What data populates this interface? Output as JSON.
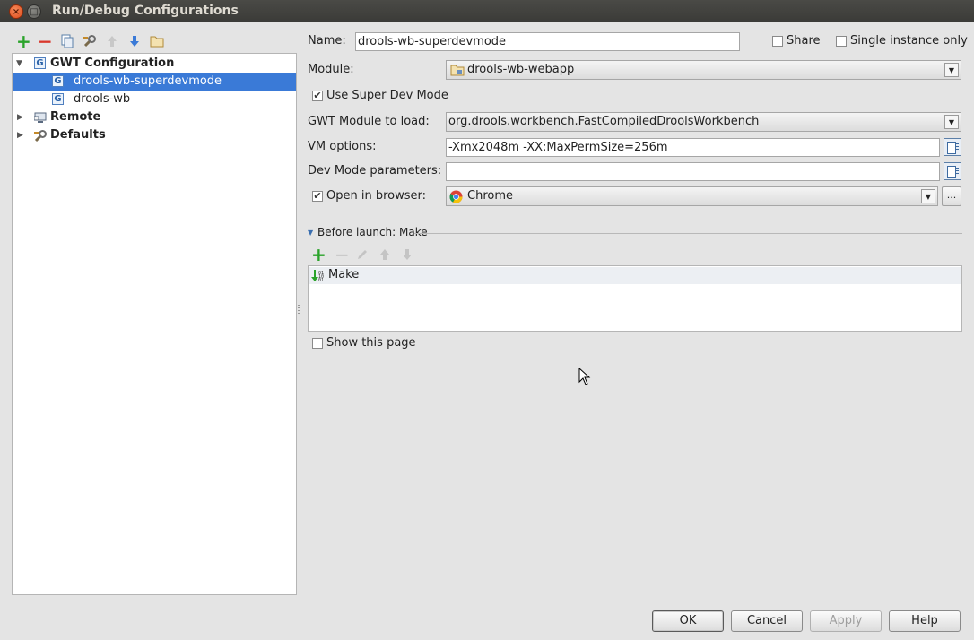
{
  "window": {
    "title": "Run/Debug Configurations",
    "close_glyph": "×",
    "maximize_glyph": "□"
  },
  "toolbar": {
    "icons": [
      "add-icon",
      "remove-icon",
      "copy-icon",
      "wrench-icon",
      "move-up-icon",
      "move-down-icon",
      "folder-icon"
    ],
    "add_glyph": "+",
    "remove_glyph": "−"
  },
  "tree": {
    "gwt": {
      "label": "GWT Configuration",
      "expanded": true
    },
    "items": [
      {
        "label": "drools-wb-superdevmode",
        "selected": true
      },
      {
        "label": "drools-wb",
        "selected": false
      }
    ],
    "remote": {
      "label": "Remote"
    },
    "defaults": {
      "label": "Defaults"
    },
    "g_glyph": "G"
  },
  "form": {
    "name_label": "Name:",
    "name_value": "drools-wb-superdevmode",
    "share_label": "Share",
    "share_checked": false,
    "single_instance_label": "Single instance only",
    "single_instance_checked": false,
    "module_label": "Module:",
    "module_value": "drools-wb-webapp",
    "use_super_dev_label": "Use Super Dev Mode",
    "use_super_dev_checked": true,
    "gwt_module_label": "GWT Module to load:",
    "gwt_module_value": "org.drools.workbench.FastCompiledDroolsWorkbench",
    "vm_options_label": "VM options:",
    "vm_options_value": "-Xmx2048m -XX:MaxPermSize=256m",
    "dev_mode_label": "Dev Mode parameters:",
    "dev_mode_value": "",
    "open_browser_label": "Open in browser:",
    "open_browser_checked": true,
    "browser_value": "Chrome",
    "browse_glyph": "...",
    "check_glyph": "✔",
    "dropdown_glyph": "▼"
  },
  "before_launch": {
    "header": "Before launch: Make",
    "tasks": [
      "Make"
    ],
    "show_page_label": "Show this page",
    "show_page_checked": false
  },
  "buttons": {
    "ok": "OK",
    "cancel": "Cancel",
    "apply": "Apply",
    "help": "Help"
  },
  "colors": {
    "selection": "#3a7ad7",
    "add_green": "#2aa32a",
    "remove_red": "#d9372c"
  }
}
